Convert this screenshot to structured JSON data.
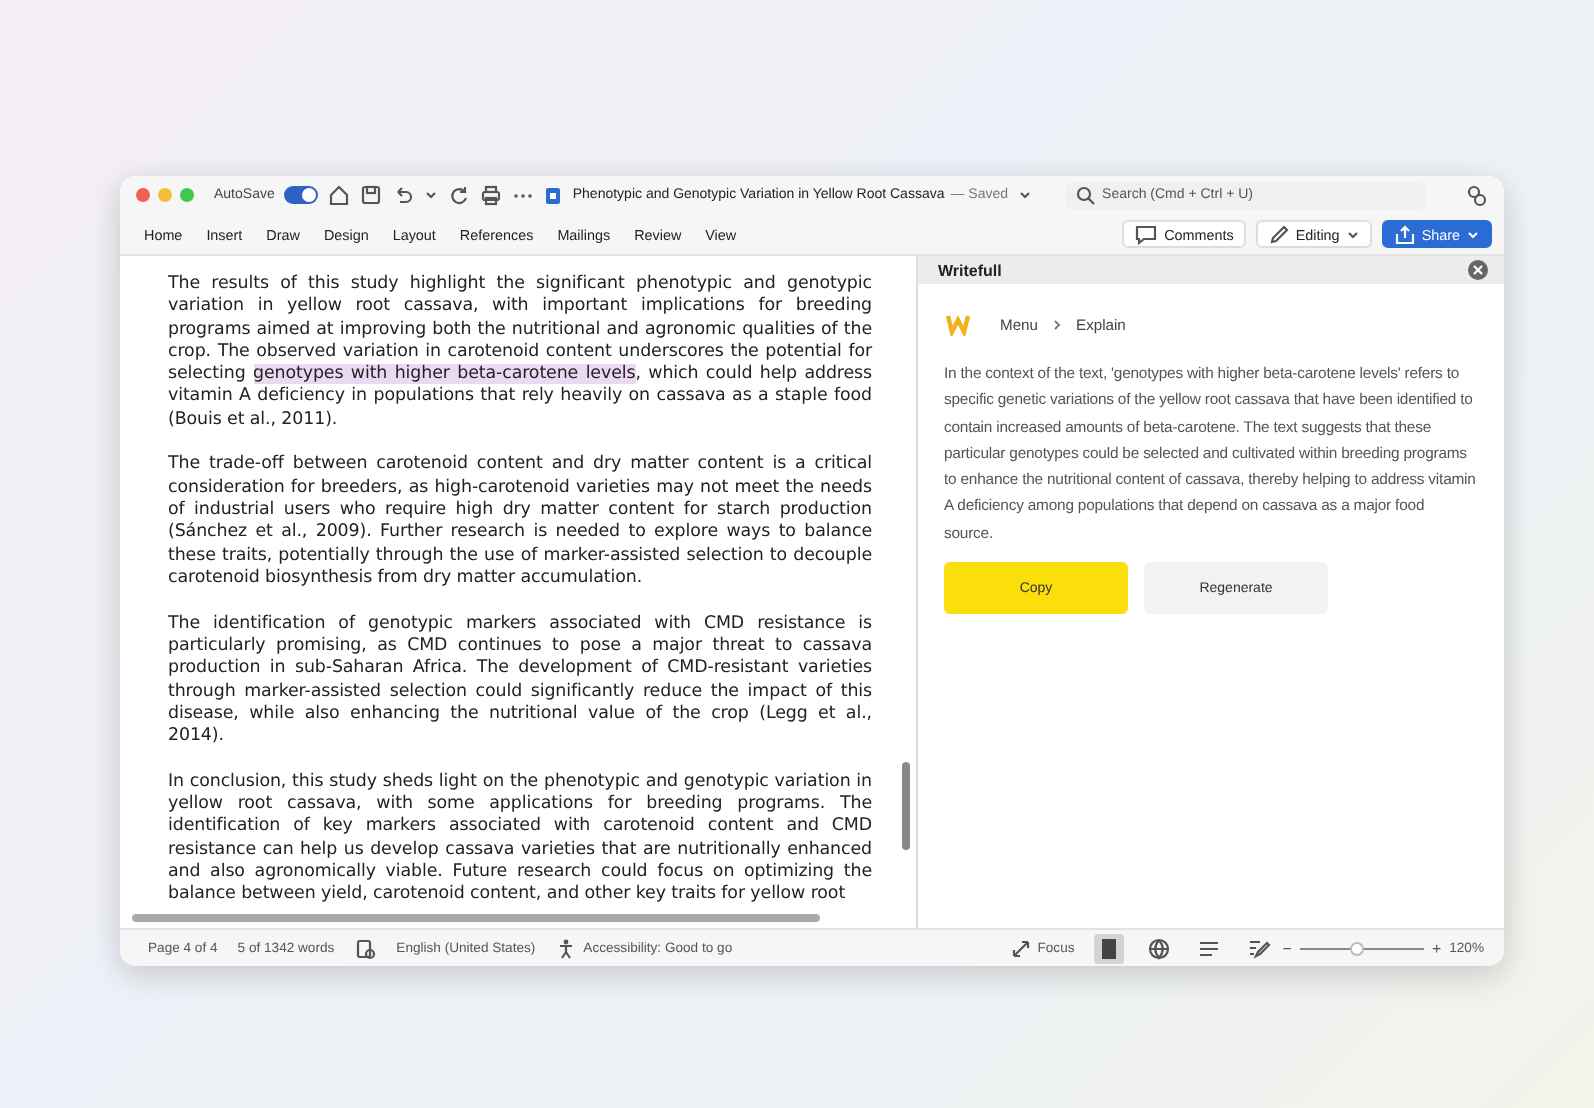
{
  "window": {
    "title": "Phenotypic and Genotypic Variation in Yellow Root Cassava",
    "saved": "— Saved",
    "autosave": {
      "label": "AutoSave",
      "on": true
    }
  },
  "search": {
    "placeholder": "Search (Cmd + Ctrl + U)"
  },
  "ribbon_tabs": [
    {
      "label": "Home",
      "selected": false
    },
    {
      "label": "Insert",
      "selected": false
    },
    {
      "label": "Draw",
      "selected": false
    },
    {
      "label": "Design",
      "selected": false
    },
    {
      "label": "Layout",
      "selected": false
    },
    {
      "label": "References",
      "selected": false
    },
    {
      "label": "Mailings",
      "selected": false
    },
    {
      "label": "Review",
      "selected": false
    },
    {
      "label": "View",
      "selected": false
    }
  ],
  "ribbon_buttons": {
    "comments": "Comments",
    "editing": "Editing",
    "share": "Share"
  },
  "document": {
    "paragraphs": [
      {
        "before": "The results of this study highlight the significant phenotypic and genotypic variation in yellow root cassava, with important implications for breeding programs aimed at improving both the nutritional and agronomic qualities of the crop. The observed variation in carotenoid content underscores the potential for selecting ",
        "highlight": "genotypes with higher beta-carotene levels",
        "after": ", which could help address vitamin A deficiency in populations that rely heavily on cassava as a staple food (Bouis et al., 2011)."
      },
      {
        "before": "The trade-off between carotenoid content and dry matter content is a critical consideration for breeders, as high-carotenoid varieties may not meet the needs of industrial users who require high dry matter content for starch production (Sánchez et al., 2009). Further research is needed to explore ways to balance these traits, potentially through the use of marker-assisted selection to decouple carotenoid biosynthesis from dry matter accumulation."
      },
      {
        "before": "The identification of genotypic markers associated with CMD resistance is particularly promising, as CMD continues to pose a major threat to cassava production in sub-Saharan Africa. The development of CMD-resistant varieties through marker-assisted selection could significantly reduce the impact of this disease, while also enhancing the nutritional value of the crop (Legg et al., 2014)."
      },
      {
        "before": "In conclusion, this study sheds light on the phenotypic and genotypic variation in yellow root cassava, with some applications for breeding programs. The identification of key markers associated with carotenoid content and CMD resistance can help us develop cassava varieties that are nutritionally enhanced and also agronomically viable. Future research could focus on optimizing the balance between yield, carotenoid content, and other key traits for yellow root"
      }
    ]
  },
  "side_panel": {
    "title": "Writefull",
    "breadcrumb": [
      "Menu",
      "Explain"
    ],
    "explanation": "In the context of the text, 'genotypes with higher beta-carotene levels' refers to specific genetic variations of the yellow root cassava that have been identified to contain increased amounts of beta-carotene. The text suggests that these particular genotypes could be selected and cultivated within breeding programs to enhance the nutritional content of cassava, thereby helping to address vitamin A deficiency among populations that depend on cassava as a major food source.",
    "buttons": [
      {
        "label": "Copy",
        "kind": "primary"
      },
      {
        "label": "Regenerate",
        "kind": "secondary"
      }
    ]
  },
  "status_bar": {
    "page": "Page 4 of 4",
    "words": "5 of 1342 words",
    "language": "English (United States)",
    "accessibility": "Accessibility: Good to go",
    "focus": "Focus",
    "views": [
      {
        "kind": "print",
        "selected": true
      },
      {
        "kind": "web",
        "selected": false
      },
      {
        "kind": "outline",
        "selected": false
      },
      {
        "kind": "draft",
        "selected": false
      }
    ],
    "zoom": {
      "minus": "−",
      "plus": "+",
      "level": 0.47,
      "reading": "120%"
    }
  }
}
